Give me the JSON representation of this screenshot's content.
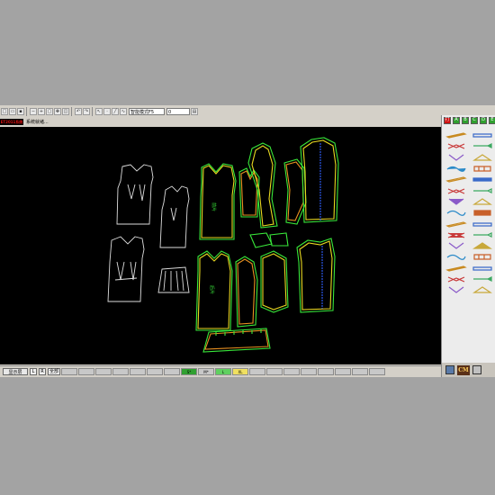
{
  "toolbar": {
    "mode_select_value": "智能模式F5",
    "zoom_value": "0",
    "buttons": [
      "new-icon",
      "open-icon",
      "save-icon",
      "zoom-out-icon",
      "zoom-in-icon",
      "zoom-box-icon",
      "pan-icon",
      "fit-icon",
      "undo-icon",
      "redo-icon",
      "pointer-icon",
      "point-icon",
      "line-icon",
      "curve-icon"
    ]
  },
  "infobar": {
    "brand_label": "ET2011系统",
    "status_text": "系统就绪..."
  },
  "right_panel": {
    "top_tabs": [
      "打",
      "A",
      "B",
      "C",
      "D",
      "E"
    ],
    "logo_text": "CM"
  },
  "statusbar": {
    "display_layer": "显示层",
    "btn_l": "L",
    "btn_r": "R",
    "btn_all": "全部",
    "cells": [
      "",
      "",
      "",
      "",
      "",
      "",
      "",
      "S*",
      "M*",
      "L",
      "XL",
      "",
      "",
      "",
      "",
      "",
      "",
      "",
      ""
    ],
    "cell_colors": [
      "#c8c8c8",
      "#c8c8c8",
      "#c8c8c8",
      "#c8c8c8",
      "#c8c8c8",
      "#c8c8c8",
      "#c8c8c8",
      "#30a030",
      "#c8c8c8",
      "#60d060",
      "#f0e060",
      "#c8c8c8",
      "#c8c8c8",
      "#c8c8c8",
      "#c8c8c8",
      "#c8c8c8",
      "#c8c8c8",
      "#c8c8c8",
      "#c8c8c8"
    ]
  },
  "colors": {
    "canvas_bg": "#000000",
    "pattern_green": "#39e83a",
    "pattern_yellow": "#e8d820",
    "pattern_orange": "#e89020",
    "pattern_blue": "#3060ff",
    "sketch_white": "#dcdcdc"
  }
}
